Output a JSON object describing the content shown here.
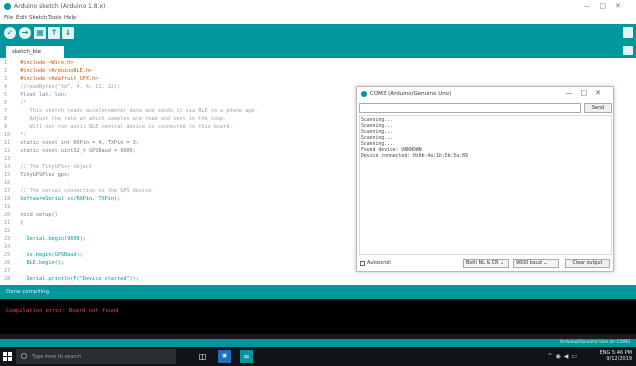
{
  "window": {
    "title": "Arduino sketch (Arduino 1.8.x)",
    "controls": [
      "—",
      "□",
      "✕"
    ]
  },
  "menu": [
    "File",
    "Edit",
    "Sketch",
    "Tools",
    "Help"
  ],
  "toolbar": {
    "verify": "✓",
    "upload": "→",
    "new": "▦",
    "open": "↑",
    "save": "↓"
  },
  "tab": {
    "label": "sketch_ble"
  },
  "code_lines": [
    {
      "n": "1",
      "text": "#include <Wire.h>"
    },
    {
      "n": "2",
      "text": "#include <ArduinoBLE.h>"
    },
    {
      "n": "3",
      "text": "#include <Adafruit_GFX.h>"
    },
    {
      "n": "4",
      "text": "//readBytes(\"%d\", 4, 4, 11, 12);"
    },
    {
      "n": "5",
      "text": "float lat, lon;"
    },
    {
      "n": "6",
      "text": "/*"
    },
    {
      "n": "7",
      "text": "   This sketch reads accelerometer data and sends it via BLE to a phone app."
    },
    {
      "n": "8",
      "text": "   Adjust the rate at which samples are read and sent in the loop."
    },
    {
      "n": "9",
      "text": "   Will not run until BLE central device is connected to this board."
    },
    {
      "n": "10",
      "text": "*/"
    },
    {
      "n": "11",
      "text": "static const int RXPin = 4, TXPin = 3;"
    },
    {
      "n": "12",
      "text": "static const uint32_t GPSBaud = 9600;"
    },
    {
      "n": "13",
      "text": ""
    },
    {
      "n": "14",
      "text": "// The TinyGPS++ object"
    },
    {
      "n": "15",
      "text": "TinyGPSPlus gps;"
    },
    {
      "n": "16",
      "text": ""
    },
    {
      "n": "17",
      "text": "// The serial connection to the GPS device"
    },
    {
      "n": "18",
      "text": "SoftwareSerial ss(RXPin, TXPin);"
    },
    {
      "n": "19",
      "text": ""
    },
    {
      "n": "20",
      "text": "void setup()"
    },
    {
      "n": "21",
      "text": "{"
    },
    {
      "n": "22",
      "text": ""
    },
    {
      "n": "23",
      "text": "  Serial.begin(9600);"
    },
    {
      "n": "24",
      "text": ""
    },
    {
      "n": "25",
      "text": "  ss.begin(GPSBaud);"
    },
    {
      "n": "26",
      "text": "  BLE.begin();"
    },
    {
      "n": "27",
      "text": ""
    },
    {
      "n": "28",
      "text": "  Serial.println(F(\"Device started\"));"
    }
  ],
  "serial_monitor": {
    "title": "COM3 (Arduino/Genuino Uno)",
    "controls": [
      "—",
      "□",
      "✕"
    ],
    "send_label": "Send",
    "input_value": "",
    "output": [
      "Scanning...",
      "Scanning...",
      "Scanning...",
      "Scanning...",
      "Scanning...",
      "Found device: UNKNOWN",
      "Device connected: 0x6b:4a:1b:5b:5a:89"
    ],
    "autoscroll_label": "Autoscroll",
    "line_ending": "Both NL & CR",
    "baud": "9600 baud",
    "clear_label": "Clear output"
  },
  "console": {
    "header": "Done compiling.",
    "message": "Compilation error: Board not found"
  },
  "status": "Arduino/Genuino Uno on COM3",
  "taskbar": {
    "search_placeholder": "Type here to search",
    "time": "5:46 PM",
    "date": "9/12/2019",
    "lang": "ENG"
  }
}
